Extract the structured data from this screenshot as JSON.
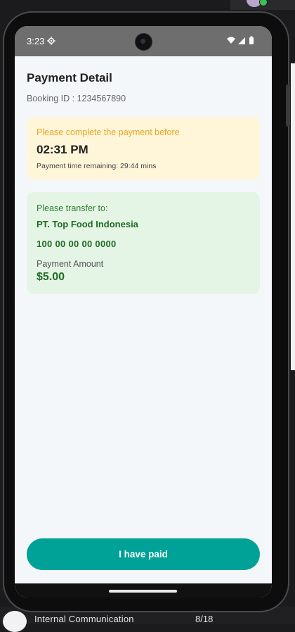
{
  "status_bar": {
    "time": "3:23"
  },
  "page": {
    "title": "Payment Detail",
    "booking_label": "Booking ID : 1234567890"
  },
  "deadline_card": {
    "label": "Please complete the payment before",
    "time": "02:31 PM",
    "remaining": "Payment time remaining: 29:44 mins",
    "background": "#fff5d8",
    "label_color": "#e7a623"
  },
  "transfer_card": {
    "label": "Please transfer to:",
    "company": "PT. Top Food Indonesia",
    "account_number": "100 00 00 00 0000",
    "amount_label": "Payment Amount",
    "amount": "$5.00",
    "background": "#e5f5e5",
    "accent": "#1e6b23"
  },
  "actions": {
    "paid_button": "I have paid",
    "button_color": "#00a196"
  },
  "background_window": {
    "item_label": "Internal Communication",
    "item_count": "8/18"
  },
  "icons": [
    "settings-gear-icon",
    "wifi-icon",
    "cellular-signal-icon",
    "battery-icon",
    "front-camera-icon"
  ]
}
